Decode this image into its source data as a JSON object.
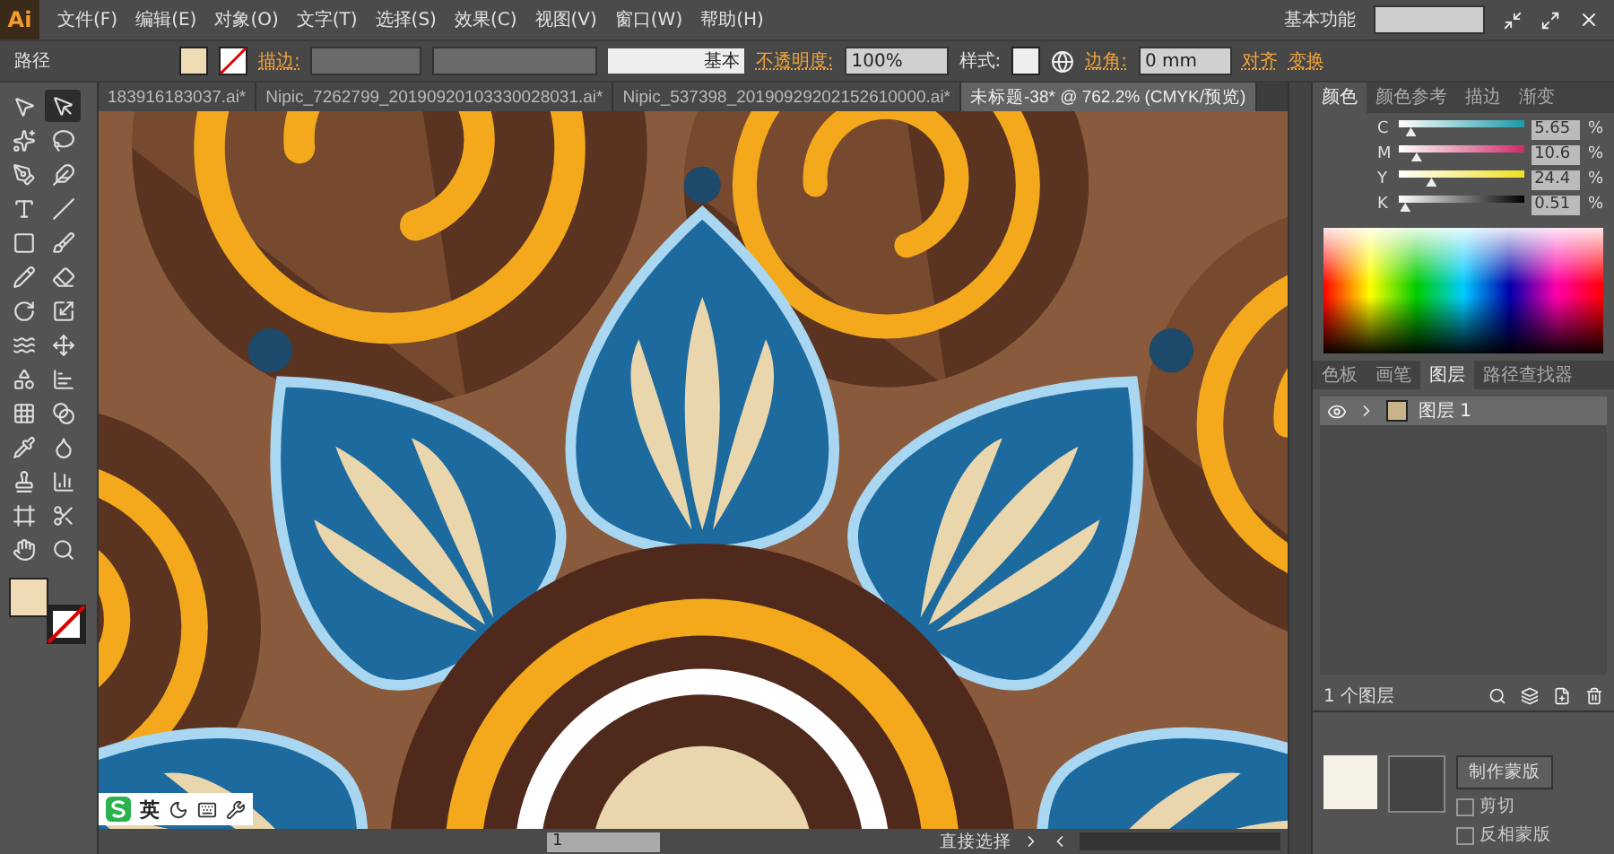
{
  "app_logo": "Ai",
  "menu": [
    "文件(F)",
    "编辑(E)",
    "对象(O)",
    "文字(T)",
    "选择(S)",
    "效果(C)",
    "视图(V)",
    "窗口(W)",
    "帮助(H)"
  ],
  "workspace": "基本功能",
  "control_bar": {
    "object_type": "路径",
    "stroke_label": "描边:",
    "stroke_profile": "基本",
    "opacity_label": "不透明度:",
    "opacity": "100%",
    "style_label": "样式:",
    "corner_label": "边角:",
    "corner_value": "0 mm",
    "align": "对齐",
    "transform": "变换"
  },
  "tabs": [
    {
      "label": "183916183037.ai*",
      "selected": false
    },
    {
      "label": "Nipic_7262799_20190920103330028031.ai*",
      "selected": false
    },
    {
      "label": "Nipic_537398_20190929202152610000.ai*",
      "selected": false
    },
    {
      "label": "未标题-38* @ 762.2% (CMYK/预览)",
      "selected": true
    }
  ],
  "tools": [
    {
      "kind": "select",
      "selected": false
    },
    {
      "kind": "direct-select",
      "selected": true
    },
    {
      "kind": "magic-wand",
      "selected": false
    },
    {
      "kind": "lasso",
      "selected": false
    },
    {
      "kind": "pen",
      "selected": false
    },
    {
      "kind": "curvature",
      "selected": false
    },
    {
      "kind": "type",
      "selected": false
    },
    {
      "kind": "line",
      "selected": false
    },
    {
      "kind": "rectangle",
      "selected": false
    },
    {
      "kind": "brush",
      "selected": false
    },
    {
      "kind": "pencil",
      "selected": false
    },
    {
      "kind": "eraser",
      "selected": false
    },
    {
      "kind": "rotate",
      "selected": false
    },
    {
      "kind": "scale",
      "selected": false
    },
    {
      "kind": "warp",
      "selected": false
    },
    {
      "kind": "free-transform",
      "selected": false
    },
    {
      "kind": "shape-builder",
      "selected": false
    },
    {
      "kind": "graph",
      "selected": false
    },
    {
      "kind": "mesh",
      "selected": false
    },
    {
      "kind": "gradient",
      "selected": false
    },
    {
      "kind": "eyedropper",
      "selected": false
    },
    {
      "kind": "blend",
      "selected": false
    },
    {
      "kind": "symbol",
      "selected": false
    },
    {
      "kind": "column-graph",
      "selected": false
    },
    {
      "kind": "artboard",
      "selected": false
    },
    {
      "kind": "slice",
      "selected": false
    },
    {
      "kind": "hand",
      "selected": false
    },
    {
      "kind": "zoom",
      "selected": false
    }
  ],
  "color_panel": {
    "tabs": [
      {
        "label": "颜色",
        "selected": true
      },
      {
        "label": "颜色参考",
        "selected": false
      },
      {
        "label": "描边",
        "selected": false
      },
      {
        "label": "渐变",
        "selected": false
      }
    ],
    "channels": [
      {
        "label": "C",
        "level": 0.06,
        "value": "5.65",
        "unit": "%"
      },
      {
        "label": "M",
        "level": 0.11,
        "value": "10.6",
        "unit": "%"
      },
      {
        "label": "Y",
        "level": 0.24,
        "value": "24.4",
        "unit": "%"
      },
      {
        "label": "K",
        "level": 0.01,
        "value": "0.51",
        "unit": "%"
      }
    ]
  },
  "layers_panel": {
    "tabs": [
      {
        "label": "色板",
        "selected": false
      },
      {
        "label": "画笔",
        "selected": false
      },
      {
        "label": "图层",
        "selected": true
      },
      {
        "label": "路径查找器",
        "selected": false
      }
    ],
    "layers": [
      {
        "name": "图层 1",
        "visible": true
      }
    ],
    "footer": "1 个图层"
  },
  "transparency_panel": {
    "make_mask": "制作蒙版",
    "options": [
      {
        "label": "剪切",
        "checked": false
      },
      {
        "label": "反相蒙版",
        "checked": false
      }
    ]
  },
  "status_bar": {
    "artboard": "1",
    "tool": "直接选择"
  },
  "ime_bar": {
    "mode": "英"
  }
}
